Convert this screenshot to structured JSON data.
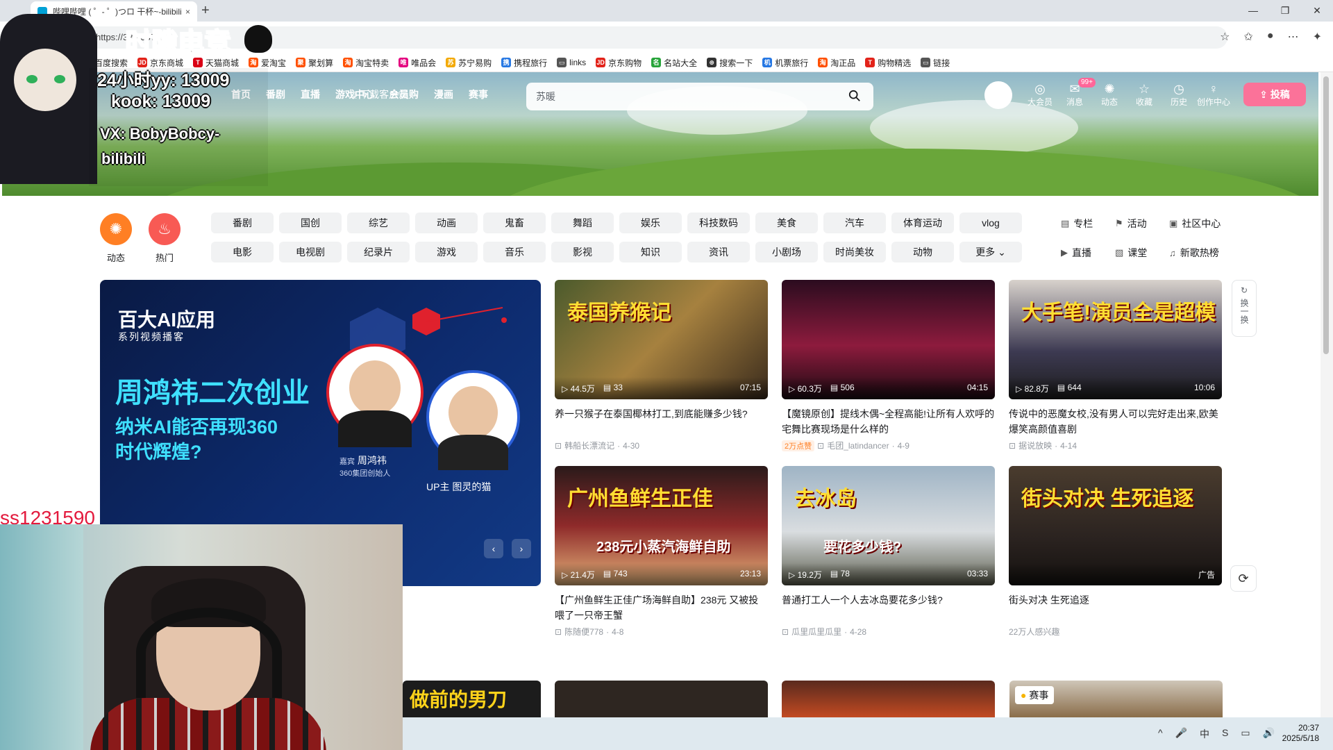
{
  "browser": {
    "tab_title": "哔哩哔哩 ( ゜- ゜)つロ 干杯~-bilibili",
    "tab_close": "×",
    "new_tab": "+",
    "url": "https://333.337.0.0",
    "bookmarks": [
      {
        "label": "百度搜索",
        "color": "#2e5ce6",
        "mark": "百"
      },
      {
        "label": "京东商城",
        "color": "#e2231a",
        "mark": "JD"
      },
      {
        "label": "天猫商城",
        "color": "#d90015",
        "mark": "T"
      },
      {
        "label": "爱淘宝",
        "color": "#ff5000",
        "mark": "淘"
      },
      {
        "label": "聚划算",
        "color": "#ff5000",
        "mark": "聚"
      },
      {
        "label": "淘宝特卖",
        "color": "#ff5000",
        "mark": "淘"
      },
      {
        "label": "唯品会",
        "color": "#e4007f",
        "mark": "唯"
      },
      {
        "label": "苏宁易购",
        "color": "#f3a900",
        "mark": "苏"
      },
      {
        "label": "携程旅行",
        "color": "#2577e3",
        "mark": "携"
      },
      {
        "label": "links",
        "color": "#555555",
        "mark": "▭"
      },
      {
        "label": "京东购物",
        "color": "#e2231a",
        "mark": "JD"
      },
      {
        "label": "名站大全",
        "color": "#27a43a",
        "mark": "名"
      },
      {
        "label": "搜索一下",
        "color": "#333333",
        "mark": "⊕"
      },
      {
        "label": "机票旅行",
        "color": "#2577e3",
        "mark": "机"
      },
      {
        "label": "淘正品",
        "color": "#ff5000",
        "mark": "淘"
      },
      {
        "label": "购物精选",
        "color": "#e2231a",
        "mark": "T"
      },
      {
        "label": "链接",
        "color": "#555555",
        "mark": "▭"
      }
    ]
  },
  "header": {
    "nav": [
      "首页",
      "番剧",
      "直播",
      "游戏中心",
      "会员购",
      "漫画",
      "赛事"
    ],
    "download": "下载客户端",
    "search_placeholder": "苏暖",
    "entries": [
      {
        "icon": "◎",
        "label": "大会员"
      },
      {
        "icon": "✉",
        "label": "消息"
      },
      {
        "icon": "✺",
        "label": "动态"
      },
      {
        "icon": "☆",
        "label": "收藏"
      },
      {
        "icon": "◷",
        "label": "历史"
      },
      {
        "icon": "♀",
        "label": "创作中心"
      }
    ],
    "message_badge": "99+",
    "upload": "投稿"
  },
  "channels": {
    "dynamic": "动态",
    "hot": "热门",
    "row1": [
      "番剧",
      "国创",
      "综艺",
      "动画",
      "鬼畜",
      "舞蹈",
      "娱乐",
      "科技数码",
      "美食",
      "汽车",
      "体育运动",
      "vlog"
    ],
    "row2": [
      "电影",
      "电视剧",
      "纪录片",
      "游戏",
      "音乐",
      "影视",
      "知识",
      "资讯",
      "小剧场",
      "时尚美妆",
      "动物",
      "更多"
    ],
    "side": [
      {
        "icon": "▤",
        "label": "专栏"
      },
      {
        "icon": "⚑",
        "label": "活动"
      },
      {
        "icon": "▣",
        "label": "社区中心"
      },
      {
        "icon": "▶",
        "label": "直播"
      },
      {
        "icon": "▧",
        "label": "课堂"
      },
      {
        "icon": "♫",
        "label": "新歌热榜"
      }
    ]
  },
  "carousel": {
    "tag": "百大AI应用",
    "series": "系列视频播客",
    "headline": "周鸿祎二次创业",
    "sub": "纳米AI能否再现360时代辉煌?",
    "guest_label": "嘉宾",
    "guest_name": "周鸿祎",
    "guest_title": "360集团创始人",
    "host": "UP主 图灵的猫",
    "prev": "‹",
    "next": "›"
  },
  "videos": [
    {
      "overlay": "泰国养猴记",
      "views": "44.5万",
      "danmaku": "33",
      "duration": "07:15",
      "title": "养一只猴子在泰国椰林打工,到底能赚多少钱?",
      "hot": "",
      "author": "韩船长漂流记",
      "date": "4-30"
    },
    {
      "overlay": "",
      "views": "60.3万",
      "danmaku": "506",
      "duration": "04:15",
      "title": "【魔镜原创】提线木偶~全程高能!让所有人欢呼的宅舞比赛现场是什么样的",
      "hot": "2万点赞",
      "author": "毛团_latindancer",
      "date": "4-9"
    },
    {
      "overlay": "大手笔!演员全是超模",
      "views": "82.8万",
      "danmaku": "644",
      "duration": "10:06",
      "title": "传说中的恶魔女校,没有男人可以完好走出来,欧美爆笑高颜值喜剧",
      "hot": "",
      "author": "据说放映",
      "date": "4-14"
    },
    {
      "overlay": "广州鱼鲜生正佳",
      "overlay2": "238元小蒸汽海鲜自助",
      "views": "21.4万",
      "danmaku": "743",
      "duration": "23:13",
      "title": "【广州鱼鲜生正佳广场海鲜自助】238元 又被投喂了一只帝王蟹",
      "hot": "",
      "author": "陈随便778",
      "date": "4-8"
    },
    {
      "overlay": "去冰岛",
      "overlay2": "要花多少钱?",
      "views": "19.2万",
      "danmaku": "78",
      "duration": "03:33",
      "title": "普通打工人一个人去冰岛要花多少钱?",
      "hot": "",
      "author": "瓜里瓜里瓜里",
      "date": "4-28"
    },
    {
      "overlay": "街头对决 生死追逐",
      "views": "",
      "danmaku": "",
      "duration": "广告",
      "title": "街头对决 生死追逐",
      "hot": "",
      "author": "22万人感兴趣",
      "date": ""
    }
  ],
  "refresh": "换一换",
  "bottom_row": {
    "first": "做前的男刀",
    "event_tag": "赛事"
  },
  "overlay": {
    "brand": "时隙电竞",
    "yy": "24小时yy: 13009",
    "kook": "kook: 13009",
    "vx": "VX: BobyBobcy-",
    "logo": "bilibili",
    "red_id": "ss1231590"
  },
  "taskbar": {
    "tray": [
      "^",
      "🎤",
      "中",
      "S",
      "▭",
      "🔊"
    ],
    "time": "20:37",
    "date": "2025/5/18"
  }
}
